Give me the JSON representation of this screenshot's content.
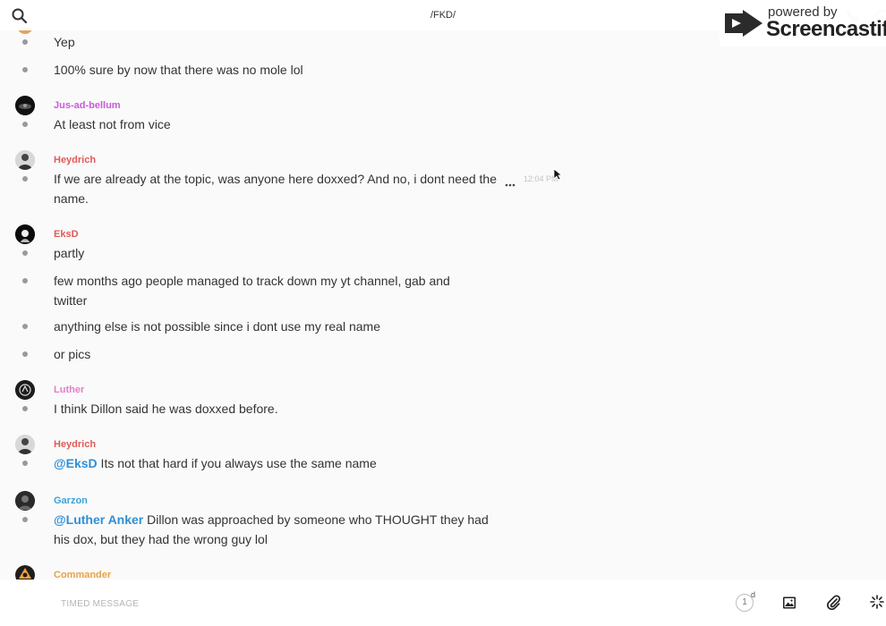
{
  "header": {
    "channel_title": "/FKD/",
    "icons": [
      "search-icon",
      "phone-icon",
      "info-icon"
    ]
  },
  "watermark": {
    "small_text": "powered by",
    "brand": "Screencastify"
  },
  "messages": [
    {
      "text": "Yep"
    },
    {
      "text": "100% sure by now that there was no mole lol"
    },
    {
      "author": "Jus-ad-bellum",
      "author_color": "#c85bd8",
      "text": "At least not from vice"
    },
    {
      "author": "Heydrich",
      "author_color": "#e05a5a",
      "text": "If we are already at the topic, was anyone here doxxed? And no, i dont need the name.",
      "time": "12:04 PM"
    },
    {
      "author": "EksD",
      "author_color": "#e05a5a",
      "text": "partly"
    },
    {
      "text": "few months ago people managed to track down my yt channel, gab and twitter"
    },
    {
      "text": "anything else is not possible since i dont use my real name"
    },
    {
      "text": "or pics"
    },
    {
      "author": "Luther",
      "author_color": "#e57fc3",
      "text": "I think Dillon said he was doxxed before."
    },
    {
      "author": "Heydrich",
      "author_color": "#e05a5a",
      "mention": "@EksD",
      "text": " Its not that hard if you always use the same name"
    },
    {
      "author": "Garzon",
      "author_color": "#3aa3d9",
      "mention": "@Luther Anker",
      "text": " Dillon was approached by someone who THOUGHT they had his dox, but they had the wrong guy lol"
    },
    {
      "author": "Commander",
      "author_color": "#e8a24a"
    }
  ],
  "composer": {
    "placeholder": "TIMED MESSAGE",
    "timer_value": "1",
    "timer_unit": "d"
  }
}
